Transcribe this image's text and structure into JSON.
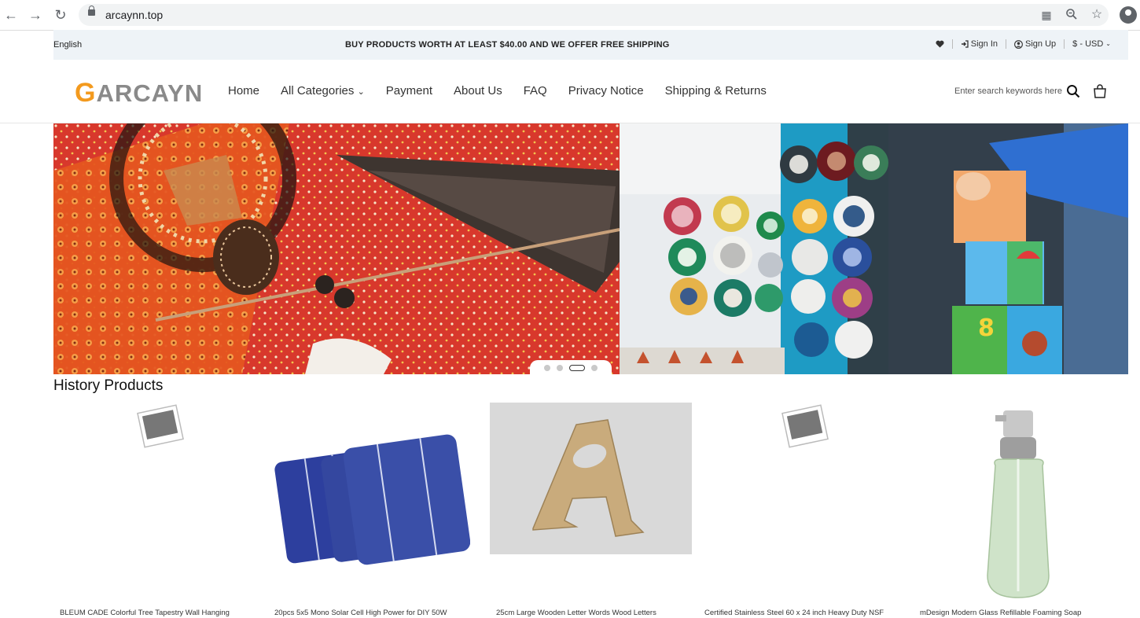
{
  "browser": {
    "url": "arcaynn.top"
  },
  "topbar": {
    "language": "English",
    "promo": "BUY PRODUCTS WORTH AT LEAST $40.00 AND WE OFFER FREE SHIPPING",
    "sign_in": "Sign In",
    "sign_up": "Sign Up",
    "currency": "$ - USD"
  },
  "header": {
    "logo_text": "ARCAYN",
    "menu": [
      "Home",
      "All Categories",
      "Payment",
      "About Us",
      "FAQ",
      "Privacy Notice",
      "Shipping & Returns"
    ],
    "search_placeholder": "Enter search keywords here"
  },
  "banner": {
    "slide_count": 4,
    "active_slide": 3
  },
  "history": {
    "title": "History Products",
    "products": [
      {
        "name": "BLEUM CADE Colorful Tree Tapestry Wall Hanging",
        "image": "placeholder"
      },
      {
        "name": "20pcs 5x5 Mono Solar Cell High Power for DIY 50W",
        "image": "solar-cells"
      },
      {
        "name": "25cm Large Wooden Letter Words Wood Letters",
        "image": "wooden-letter-a"
      },
      {
        "name": "Certified Stainless Steel 60 x 24 inch Heavy Duty NSF",
        "image": "placeholder"
      },
      {
        "name": "mDesign Modern Glass Refillable Foaming Soap",
        "image": "soap-dispenser"
      }
    ]
  }
}
